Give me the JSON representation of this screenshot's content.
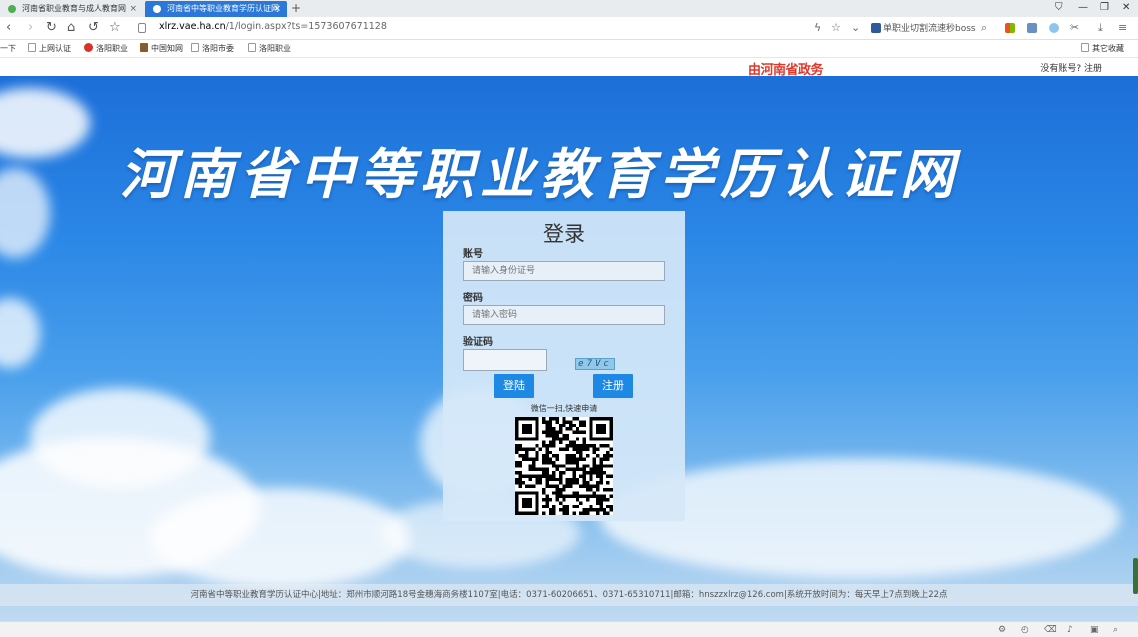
{
  "browser": {
    "tabs": [
      {
        "label": "河南省职业教育与成人教育网",
        "active": false
      },
      {
        "label": "河南省中等职业教育学历认证网",
        "active": true
      }
    ],
    "address": {
      "host": "xlrz.vae.ha.cn",
      "path": "/1/login.aspx?ts=1573607671128"
    },
    "search_text": "单职业切割流速秒boss",
    "bookmarks": [
      "一下",
      "上网认证",
      "洛阳职业",
      "中国知网",
      "洛阳市委",
      "洛阳职业"
    ],
    "bookmarks_other": "其它收藏"
  },
  "header": {
    "gov_banner": "由河南省政务",
    "no_account": "没有账号?",
    "register_link": "注册"
  },
  "site_title": "河南省中等职业教育学历认证网",
  "login": {
    "title": "登录",
    "account_label": "账号",
    "account_placeholder": "请输入身份证号",
    "password_label": "密码",
    "password_placeholder": "请输入密码",
    "captcha_label": "验证码",
    "captcha_text": "e7Vc",
    "login_button": "登陆",
    "register_button": "注册",
    "wechat_note": "微信一扫,快速申请"
  },
  "footer": {
    "text": "河南省中等职业教育学历认证中心|地址：郑州市顺河路18号金穗海商务楼1107室|电话：0371-60206651、0371-65310711|邮箱：hnszzxlrz@126.com|系统开放时间为：每天早上7点到晚上22点"
  },
  "colors": {
    "primary": "#1e88e5",
    "gov_red": "#e0372a",
    "tab_active": "#2b78d8"
  }
}
